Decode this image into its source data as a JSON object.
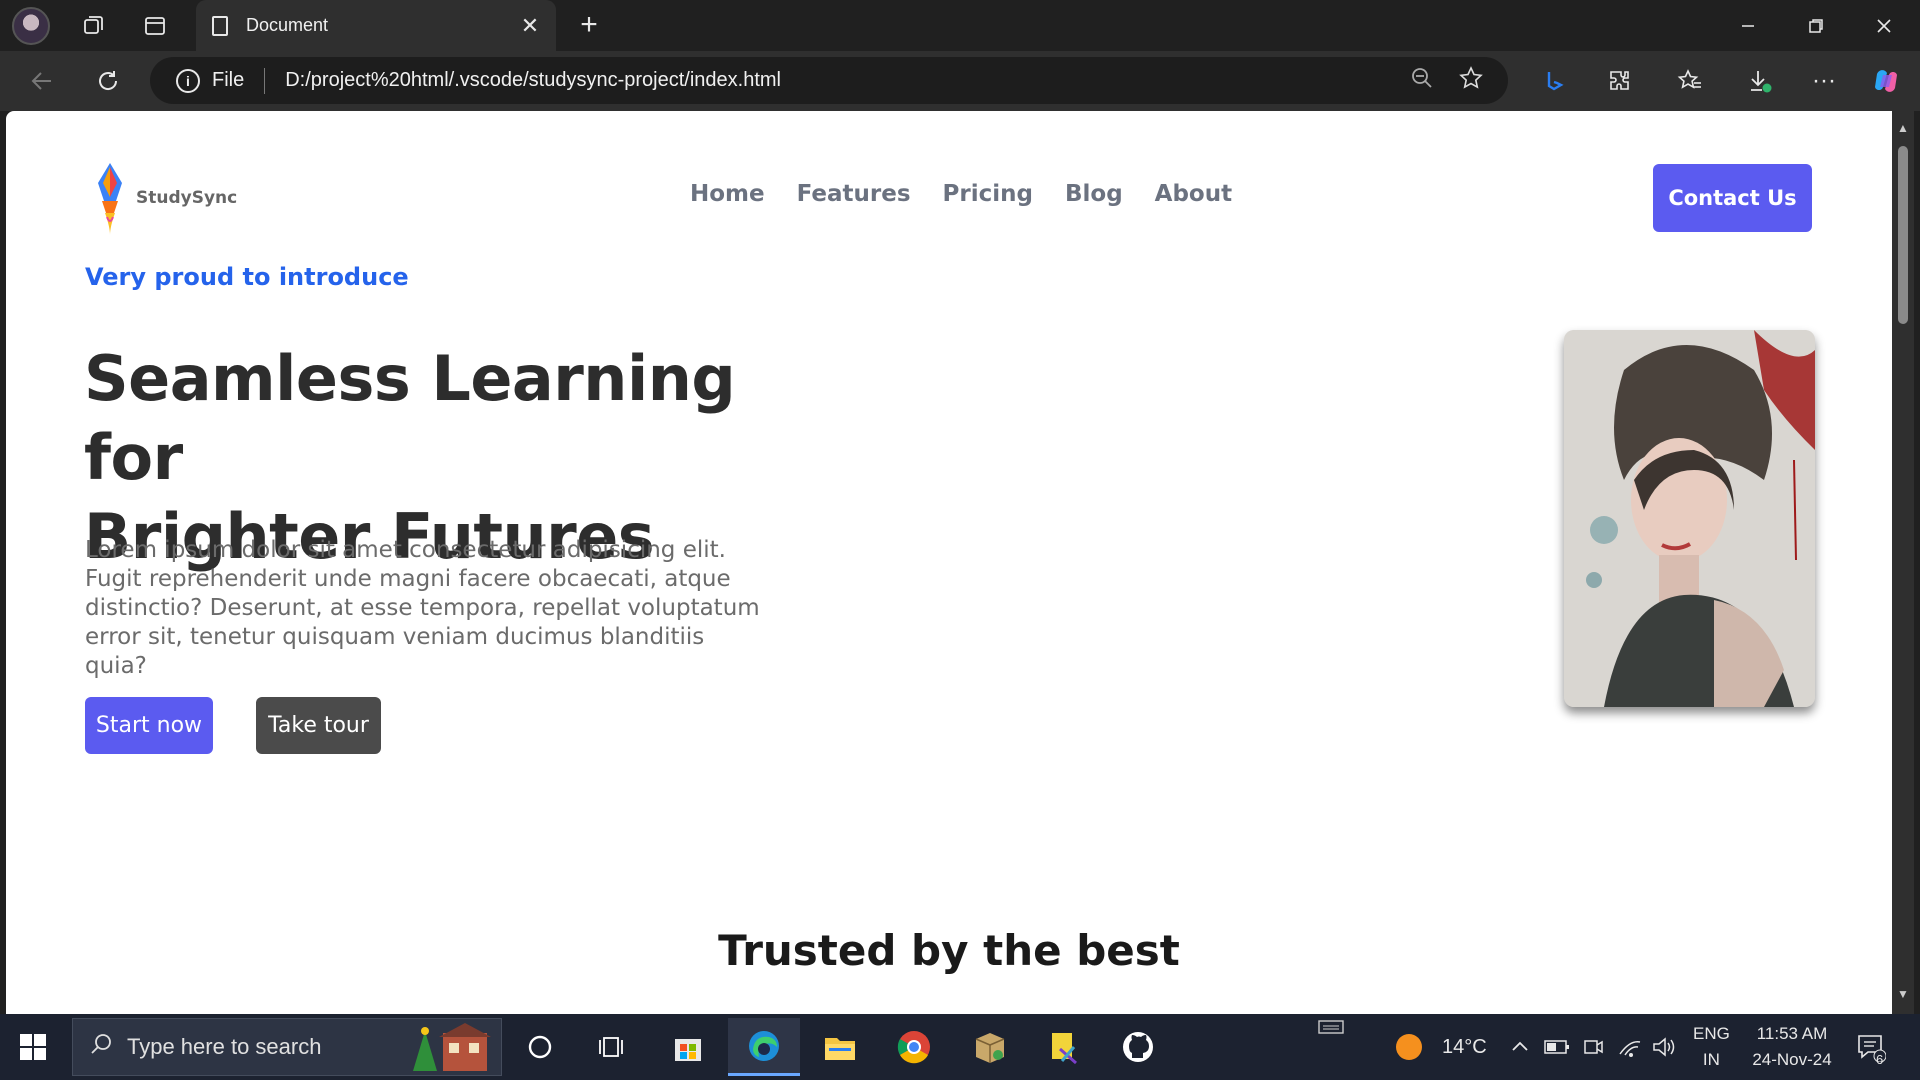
{
  "browser": {
    "tab_title": "Document",
    "address_prefix": "File",
    "url": "D:/project%20html/.vscode/studysync-project/index.html"
  },
  "page": {
    "brand": "StudySync",
    "nav": [
      "Home",
      "Features",
      "Pricing",
      "Blog",
      "About"
    ],
    "contact_label": "Contact Us",
    "eyebrow": "Very proud to introduce",
    "headline_line1": "Seamless Learning for",
    "headline_line2": "Brighter Futures",
    "paragraph": "Lorem ipsum dolor sit amet consectetur adipisicing elit. Fugit reprehenderit unde magni facere obcaecati, atque distinctio? Deserunt, at esse tempora, repellat voluptatum error sit, tenetur quisquam veniam ducimus blanditiis quia?",
    "start_label": "Start now",
    "tour_label": "Take tour",
    "section_title": "Trusted by the best"
  },
  "taskbar": {
    "search_placeholder": "Type here to search",
    "weather_temp": "14°C",
    "lang_top": "ENG",
    "lang_bottom": "IN",
    "time": "11:53 AM",
    "date": "24-Nov-24",
    "notification_count": "6"
  },
  "colors": {
    "accent": "#5b5bf0",
    "eyebrow": "#2563eb",
    "dark_button": "#4b4b4b"
  }
}
